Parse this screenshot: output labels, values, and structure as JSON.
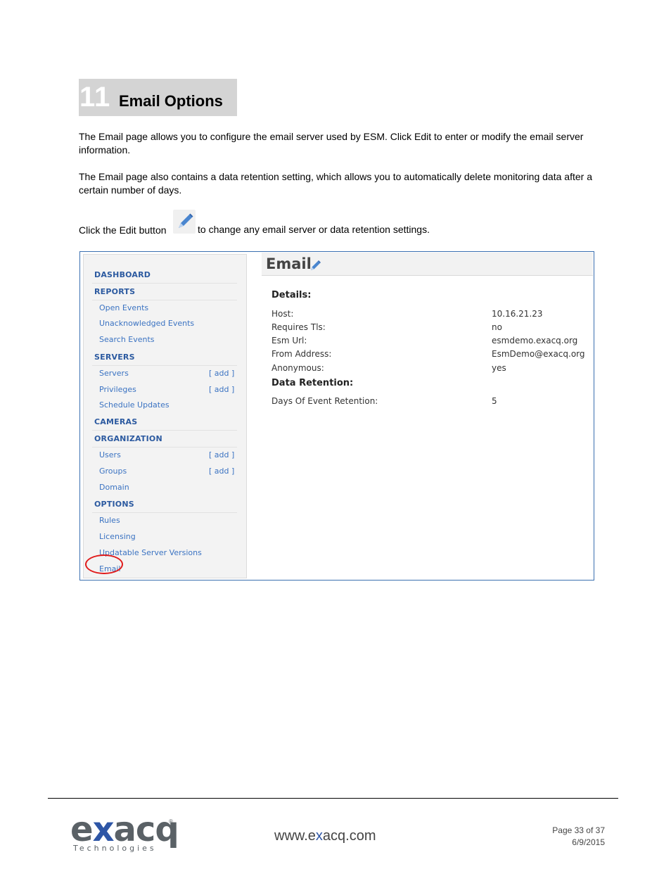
{
  "heading": {
    "number": "11",
    "title": "Email Options"
  },
  "paragraphs": [
    "The Email page allows you to configure the email server used by ESM. Click Edit to enter or modify the email server information.",
    "The Email page also contains a data retention setting, which allows you to automatically delete monitoring data after a certain number of days."
  ],
  "edit_line": {
    "before": "Click the Edit button",
    "after": "to change any email server or data retention settings."
  },
  "icons": {
    "edit": "pencil-icon"
  },
  "sidebar": {
    "dashboard": "DASHBOARD",
    "reports": "REPORTS",
    "open_events": "Open Events",
    "unack_events": "Unacknowledged Events",
    "search_events": "Search Events",
    "servers_head": "SERVERS",
    "servers": "Servers",
    "privileges": "Privileges",
    "schedule_updates": "Schedule Updates",
    "cameras": "CAMERAS",
    "organization": "ORGANIZATION",
    "users": "Users",
    "groups": "Groups",
    "domain": "Domain",
    "options": "OPTIONS",
    "rules": "Rules",
    "licensing": "Licensing",
    "updatable": "Updatable Server Versions",
    "email": "Email",
    "add": "[ add ]"
  },
  "email_panel": {
    "title": "Email",
    "details_title": "Details:",
    "host_label": "Host:",
    "host_value": "10.16.21.23",
    "tls_label": "Requires Tls:",
    "tls_value": "no",
    "url_label": "Esm Url:",
    "url_value": "esmdemo.exacq.org",
    "from_label": "From Address:",
    "from_value": "EsmDemo@exacq.org",
    "anon_label": "Anonymous:",
    "anon_value": "yes",
    "retention_title": "Data Retention:",
    "days_label": "Days Of Event Retention:",
    "days_value": "5"
  },
  "footer": {
    "logo_e": "e",
    "logo_x": "x",
    "logo_rest": "acq",
    "logo_sub": "Technologies",
    "logo_reg": "®",
    "site_a": "www.e",
    "site_x": "x",
    "site_b": "acq.com",
    "page": "Page 33 of 37",
    "date": "6/9/2015"
  },
  "colors": {
    "accent": "#2e56a6",
    "link": "#3b73c2",
    "circle": "#e01b1b"
  }
}
